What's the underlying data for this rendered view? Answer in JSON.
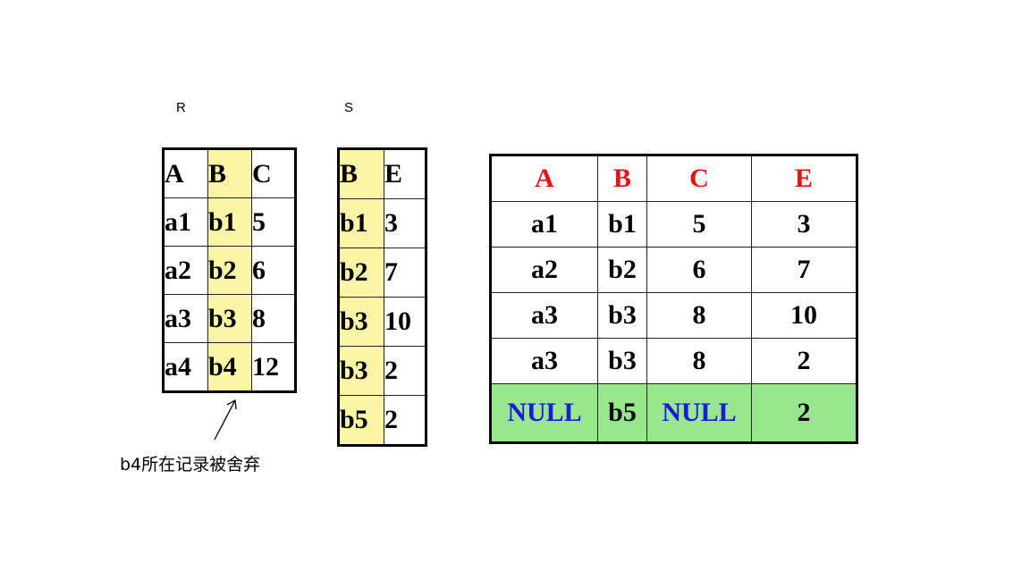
{
  "labels": {
    "r": "R",
    "s": "S"
  },
  "table_r": {
    "headers": [
      "A",
      "B",
      "C"
    ],
    "rows": [
      [
        "a1",
        "b1",
        "5"
      ],
      [
        "a2",
        "b2",
        "6"
      ],
      [
        "a3",
        "b3",
        "8"
      ],
      [
        "a4",
        "b4",
        "12"
      ]
    ]
  },
  "table_s": {
    "headers": [
      "B",
      "E"
    ],
    "rows": [
      [
        "b1",
        "3"
      ],
      [
        "b2",
        "7"
      ],
      [
        "b3",
        "10"
      ],
      [
        "b3",
        "2"
      ],
      [
        "b5",
        "2"
      ]
    ]
  },
  "table_result": {
    "headers": [
      "A",
      "B",
      "C",
      "E"
    ],
    "rows": [
      [
        "a1",
        "b1",
        "5",
        "3"
      ],
      [
        "a2",
        "b2",
        "6",
        "7"
      ],
      [
        "a3",
        "b3",
        "8",
        "10"
      ],
      [
        "a3",
        "b3",
        "8",
        "2"
      ],
      [
        "NULL",
        "b5",
        "NULL",
        "2"
      ]
    ]
  },
  "annotation": "b4所在记录被舍弃",
  "colors": {
    "header_pink": "#e8106a",
    "header_red": "#e81010",
    "highlight_yellow": "#fbf5a6",
    "null_row_green": "#98e68e",
    "blue_text": "#1a1ad8"
  }
}
